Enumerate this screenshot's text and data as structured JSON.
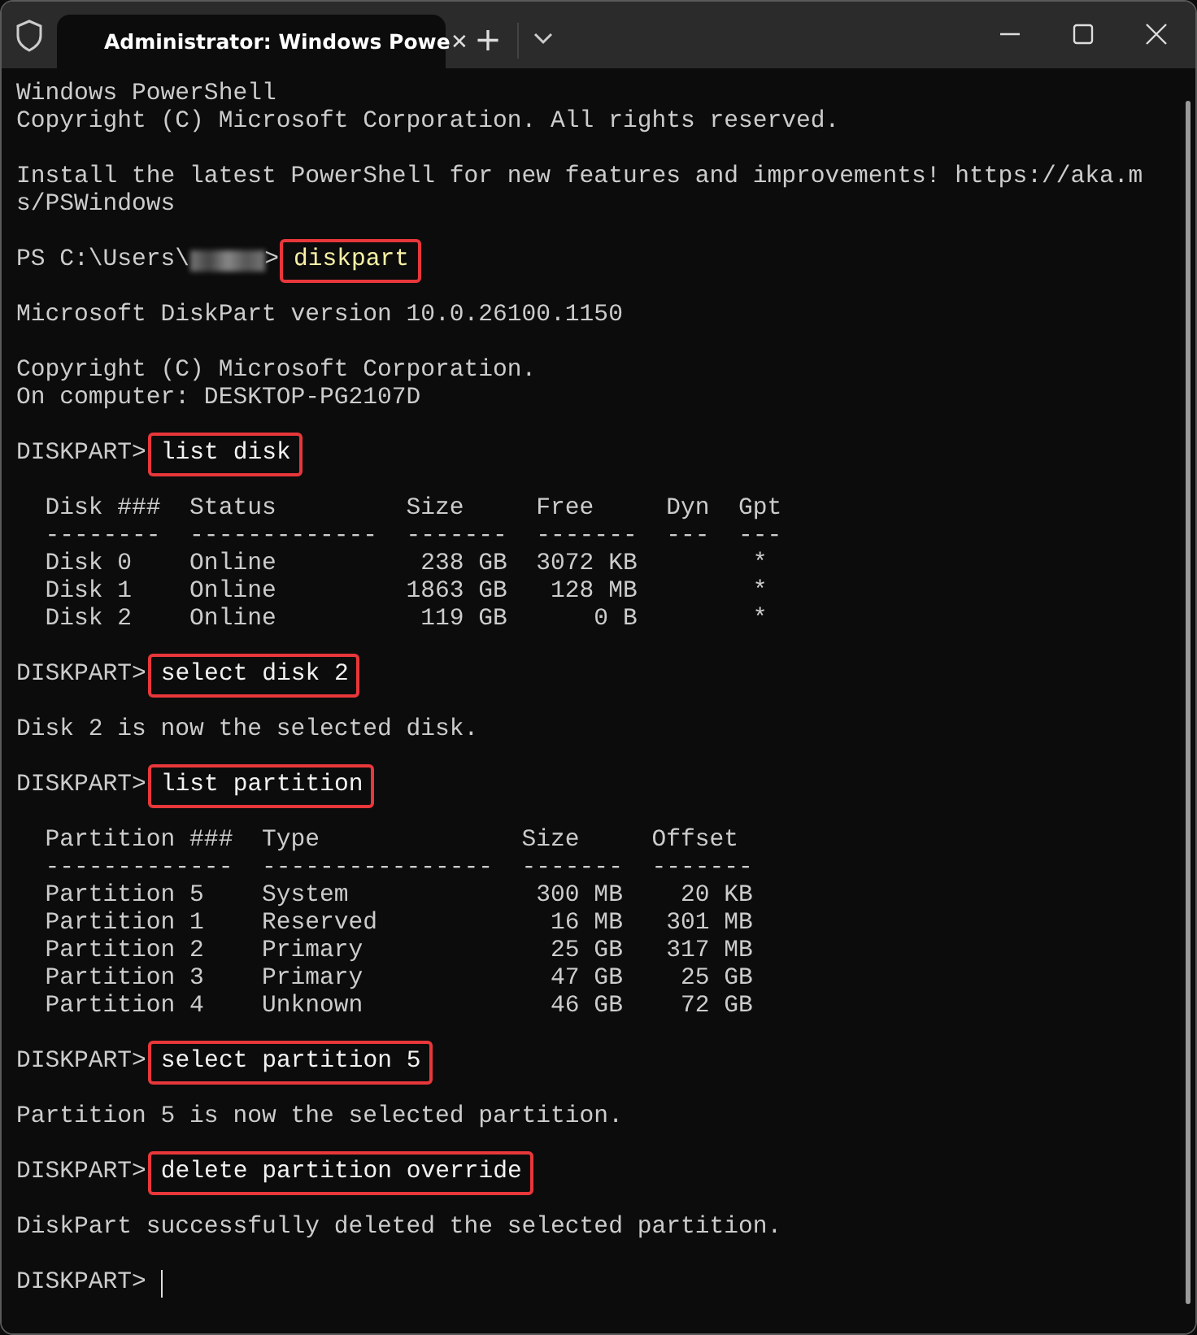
{
  "title_bar": {
    "tab_title": "Administrator: Windows Powe",
    "close_tab": "✕",
    "new_tab": "+"
  },
  "console": {
    "lines": [
      {
        "kind": "text",
        "text": "Windows PowerShell"
      },
      {
        "kind": "text",
        "text": "Copyright (C) Microsoft Corporation. All rights reserved."
      },
      {
        "kind": "blank"
      },
      {
        "kind": "text",
        "text": "Install the latest PowerShell for new features and improvements! https://aka.m"
      },
      {
        "kind": "text",
        "text": "s/PSWindows"
      },
      {
        "kind": "blank"
      },
      {
        "kind": "redacted-prompt",
        "prompt_start": "PS C:\\Users\\",
        "prompt_end": ">",
        "command": "diskpart"
      },
      {
        "kind": "blank"
      },
      {
        "kind": "text",
        "text": "Microsoft DiskPart version 10.0.26100.1150"
      },
      {
        "kind": "blank"
      },
      {
        "kind": "text",
        "text": "Copyright (C) Microsoft Corporation."
      },
      {
        "kind": "text",
        "text": "On computer: DESKTOP-PG2107D"
      },
      {
        "kind": "blank"
      },
      {
        "kind": "prompt",
        "prompt": "DISKPART>",
        "command": "list disk"
      },
      {
        "kind": "blank"
      },
      {
        "kind": "text",
        "text": "  Disk ###  Status         Size     Free     Dyn  Gpt"
      },
      {
        "kind": "text",
        "text": "  --------  -------------  -------  -------  ---  ---"
      },
      {
        "kind": "text",
        "text": "  Disk 0    Online          238 GB  3072 KB        *"
      },
      {
        "kind": "text",
        "text": "  Disk 1    Online         1863 GB   128 MB        *"
      },
      {
        "kind": "text",
        "text": "  Disk 2    Online          119 GB      0 B        *"
      },
      {
        "kind": "blank"
      },
      {
        "kind": "prompt",
        "prompt": "DISKPART>",
        "command": "select disk 2"
      },
      {
        "kind": "blank"
      },
      {
        "kind": "text",
        "text": "Disk 2 is now the selected disk."
      },
      {
        "kind": "blank"
      },
      {
        "kind": "prompt",
        "prompt": "DISKPART>",
        "command": "list partition"
      },
      {
        "kind": "blank"
      },
      {
        "kind": "text",
        "text": "  Partition ###  Type              Size     Offset"
      },
      {
        "kind": "text",
        "text": "  -------------  ----------------  -------  -------"
      },
      {
        "kind": "text",
        "text": "  Partition 5    System             300 MB    20 KB"
      },
      {
        "kind": "text",
        "text": "  Partition 1    Reserved            16 MB   301 MB"
      },
      {
        "kind": "text",
        "text": "  Partition 2    Primary             25 GB   317 MB"
      },
      {
        "kind": "text",
        "text": "  Partition 3    Primary             47 GB    25 GB"
      },
      {
        "kind": "text",
        "text": "  Partition 4    Unknown             46 GB    72 GB"
      },
      {
        "kind": "blank"
      },
      {
        "kind": "prompt",
        "prompt": "DISKPART>",
        "command": "select partition 5"
      },
      {
        "kind": "blank"
      },
      {
        "kind": "text",
        "text": "Partition 5 is now the selected partition."
      },
      {
        "kind": "blank"
      },
      {
        "kind": "prompt",
        "prompt": "DISKPART>",
        "command": "delete partition override"
      },
      {
        "kind": "blank"
      },
      {
        "kind": "text",
        "text": "DiskPart successfully deleted the selected partition."
      },
      {
        "kind": "blank"
      },
      {
        "kind": "cursor",
        "prompt": "DISKPART>"
      }
    ]
  }
}
